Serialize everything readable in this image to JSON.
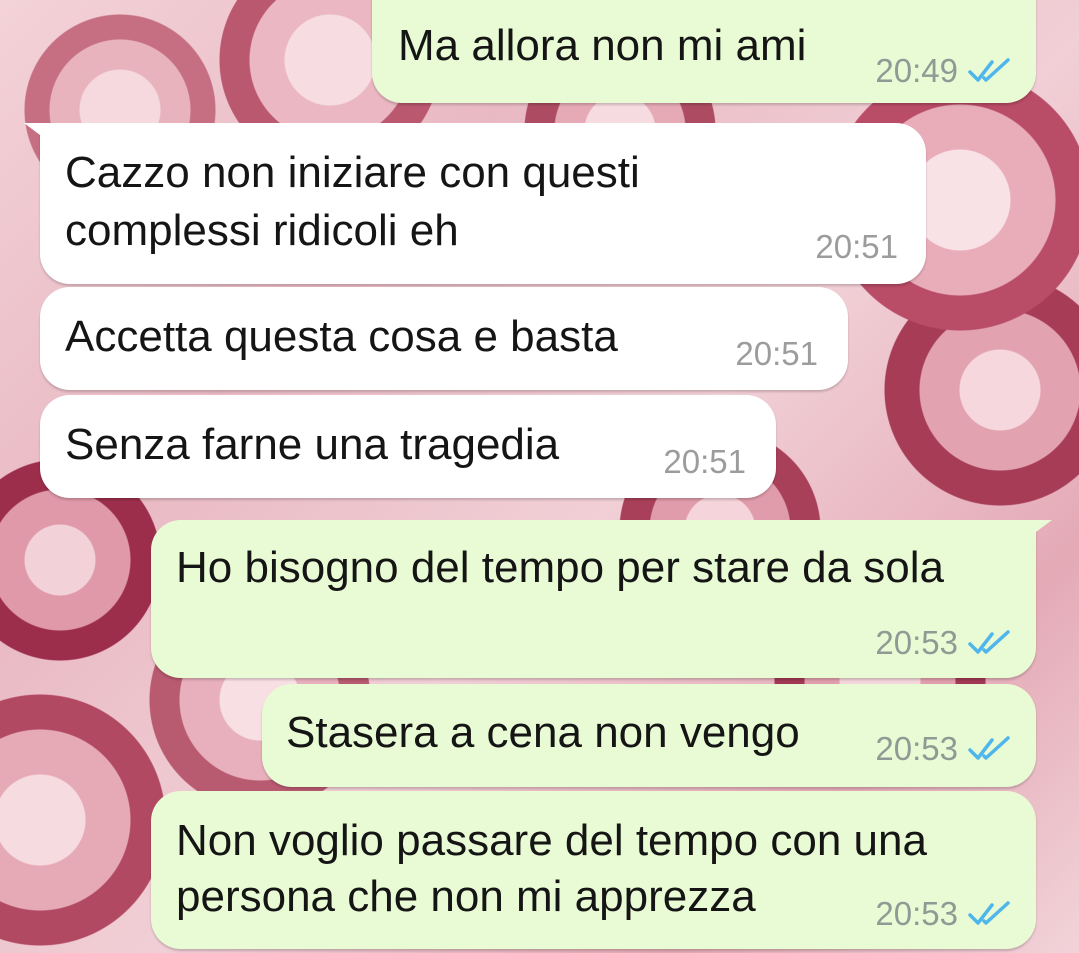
{
  "messages": [
    {
      "direction": "outgoing",
      "lines": [
        "Ma allora non mi ami"
      ],
      "time": "20:49",
      "status": "read",
      "status_icon": "double-check-icon"
    },
    {
      "direction": "incoming",
      "lines": [
        "Cazzo non iniziare con questi",
        "complessi ridicoli eh"
      ],
      "time": "20:51"
    },
    {
      "direction": "incoming",
      "lines": [
        "Accetta questa cosa e basta"
      ],
      "time": "20:51"
    },
    {
      "direction": "incoming",
      "lines": [
        "Senza farne una tragedia"
      ],
      "time": "20:51"
    },
    {
      "direction": "outgoing",
      "lines": [
        "Ho bisogno del tempo per stare da sola"
      ],
      "time": "20:53",
      "status": "read",
      "status_icon": "double-check-icon"
    },
    {
      "direction": "outgoing",
      "lines": [
        "Stasera a cena non vengo"
      ],
      "time": "20:53",
      "status": "read",
      "status_icon": "double-check-icon"
    },
    {
      "direction": "outgoing",
      "lines": [
        "Non voglio passare del tempo con una",
        "persona che non mi apprezza"
      ],
      "time": "20:53",
      "status": "read",
      "status_icon": "double-check-icon"
    }
  ],
  "colors": {
    "outgoing_bubble": "#e9fbd5",
    "incoming_bubble": "#ffffff",
    "read_ticks": "#4fb6ec",
    "timestamp": "#8e9a93"
  }
}
